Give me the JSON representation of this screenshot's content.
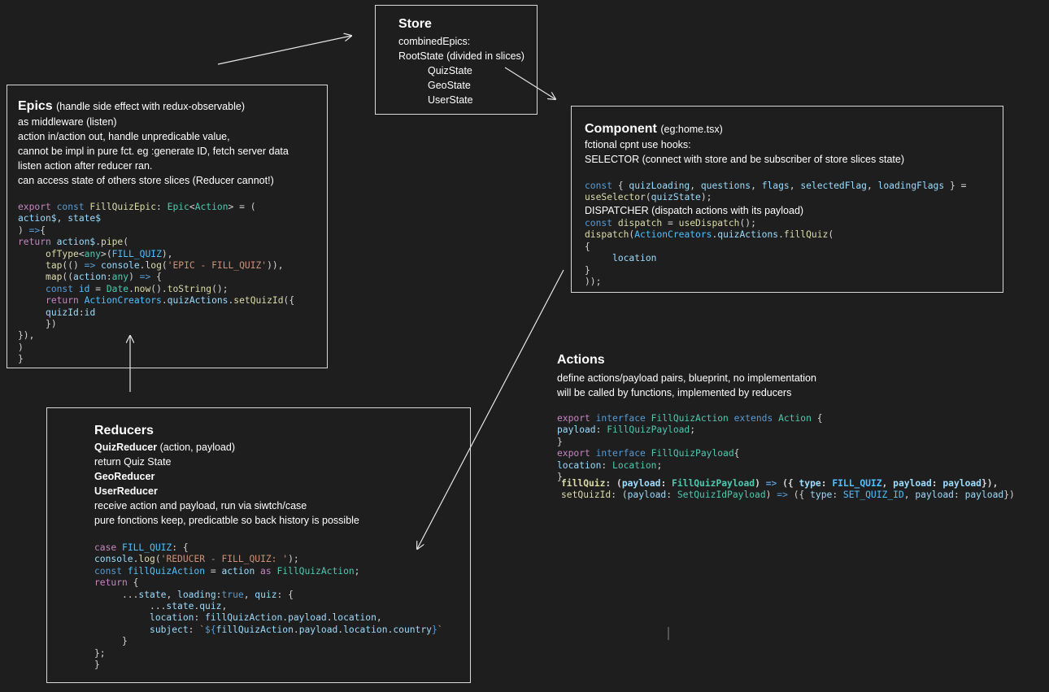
{
  "store": {
    "title": "Store",
    "lines": [
      "combinedEpics:",
      "RootState (divided in slices)",
      "QuizState",
      "GeoState",
      "UserState"
    ]
  },
  "epics": {
    "title": "Epics",
    "subtitle": "(handle side effect with redux-observable)",
    "lines": [
      "as middleware (listen)",
      "action in/action out, handle unpredicable value,",
      "cannot be impl in pure fct. eg :generate ID, fetch server data",
      "listen action after reducer ran.",
      "can access state of others store slices (Reducer cannot!)"
    ],
    "code": [
      [
        [
          "kw",
          "export "
        ],
        [
          "kb",
          "const "
        ],
        [
          "fn",
          "FillQuizEpic"
        ],
        [
          "",
          "："
        ],
        [
          "ty",
          "Epic"
        ],
        [
          "",
          "<"
        ],
        [
          "ty",
          "Action"
        ],
        [
          "",
          "> = ("
        ]
      ],
      [
        [
          "vr",
          "action$"
        ],
        [
          "",
          ", "
        ],
        [
          "vr",
          "state$"
        ]
      ],
      [
        [
          "",
          ") "
        ],
        [
          "kb",
          "=>"
        ],
        [
          "",
          "{"
        ]
      ],
      [
        [
          "kw",
          "return "
        ],
        [
          "vr",
          "action$"
        ],
        [
          "",
          "."
        ],
        [
          "fn",
          "pipe"
        ],
        [
          "",
          "("
        ]
      ],
      [
        [
          "",
          "     "
        ],
        [
          "fn",
          "ofType"
        ],
        [
          "",
          "<"
        ],
        [
          "ty",
          "any"
        ],
        [
          "",
          ">("
        ],
        [
          "cn",
          "FILL_QUIZ"
        ],
        [
          "",
          "),"
        ]
      ],
      [
        [
          "",
          "     "
        ],
        [
          "fn",
          "tap"
        ],
        [
          "",
          "(() "
        ],
        [
          "kb",
          "=> "
        ],
        [
          "vr",
          "console"
        ],
        [
          "",
          "."
        ],
        [
          "fn",
          "log"
        ],
        [
          "",
          "("
        ],
        [
          "st",
          "'EPIC - FILL_QUIZ'"
        ],
        [
          "",
          ")),"
        ]
      ],
      [
        [
          "",
          "     "
        ],
        [
          "fn",
          "map"
        ],
        [
          "",
          "(("
        ],
        [
          "vr",
          "action"
        ],
        [
          "",
          ":"
        ],
        [
          "ty",
          "any"
        ],
        [
          "",
          ") "
        ],
        [
          "kb",
          "=> "
        ],
        [
          "",
          "{"
        ]
      ],
      [
        [
          "",
          "     "
        ],
        [
          "kb",
          "const "
        ],
        [
          "cn",
          "id"
        ],
        [
          "",
          " = "
        ],
        [
          "ty",
          "Date"
        ],
        [
          "",
          "."
        ],
        [
          "fn",
          "now"
        ],
        [
          "",
          "()."
        ],
        [
          "fn",
          "toString"
        ],
        [
          "",
          "();"
        ]
      ],
      [
        [
          "",
          "     "
        ],
        [
          "kw",
          "return "
        ],
        [
          "cn",
          "ActionCreators"
        ],
        [
          "",
          "."
        ],
        [
          "vr",
          "quizActions"
        ],
        [
          "",
          "."
        ],
        [
          "fn",
          "setQuizId"
        ],
        [
          "",
          "({"
        ]
      ],
      [
        [
          "",
          "     "
        ],
        [
          "vr",
          "quizId"
        ],
        [
          "",
          ":"
        ],
        [
          "vr",
          "id"
        ]
      ],
      [
        [
          "",
          "     "
        ],
        [
          "",
          "})"
        ]
      ],
      [
        [
          "",
          "}),"
        ]
      ],
      [
        [
          "",
          ")"
        ]
      ],
      [
        [
          "",
          "}"
        ]
      ]
    ]
  },
  "component": {
    "title": "Component",
    "subtitle": "(eg:home.tsx)",
    "lines": [
      "fctional cpnt use hooks:",
      "SELECTOR (connect with store and be subscriber of store slices state)"
    ],
    "dispatcher_label": "DISPATCHER (dispatch actions with its payload)",
    "code_a": [
      [
        [
          "kb",
          "const "
        ],
        [
          "",
          "{ "
        ],
        [
          "vr",
          "quizLoading"
        ],
        [
          "",
          ", "
        ],
        [
          "vr",
          "questions"
        ],
        [
          "",
          ", "
        ],
        [
          "vr",
          "flags"
        ],
        [
          "",
          ", "
        ],
        [
          "vr",
          "selectedFlag"
        ],
        [
          "",
          ", "
        ],
        [
          "vr",
          "loadingFlags"
        ],
        [
          "",
          " } ="
        ]
      ],
      [
        [
          "fn",
          "useSelector"
        ],
        [
          "",
          "("
        ],
        [
          "vr",
          "quizState"
        ],
        [
          "",
          ");"
        ]
      ]
    ],
    "code_b": [
      [
        [
          "kb",
          "const "
        ],
        [
          "fn",
          "dispatch"
        ],
        [
          "",
          " = "
        ],
        [
          "fn",
          "useDispatch"
        ],
        [
          "",
          "();"
        ]
      ],
      [
        [
          "fn",
          "dispatch"
        ],
        [
          "",
          "("
        ],
        [
          "cn",
          "ActionCreators"
        ],
        [
          "",
          "."
        ],
        [
          "vr",
          "quizActions"
        ],
        [
          "",
          "."
        ],
        [
          "fn",
          "fillQuiz"
        ],
        [
          "",
          "("
        ]
      ],
      [
        [
          "",
          "{"
        ]
      ],
      [
        [
          "",
          "     "
        ],
        [
          "vr",
          "location"
        ]
      ],
      [
        [
          "",
          "}"
        ]
      ],
      [
        [
          "",
          "));"
        ]
      ]
    ]
  },
  "actions": {
    "title": "Actions",
    "lines": [
      "define actions/payload pairs, blueprint, no implementation",
      "will be called by functions, implemented by reducers"
    ],
    "code": [
      [
        [
          "kw",
          "export "
        ],
        [
          "kb",
          "interface "
        ],
        [
          "ty",
          "FillQuizAction "
        ],
        [
          "kb",
          "extends "
        ],
        [
          "ty",
          "Action "
        ],
        [
          "",
          "{"
        ]
      ],
      [
        [
          "vr",
          "payload"
        ],
        [
          "",
          ": "
        ],
        [
          "ty",
          "FillQuizPayload"
        ],
        [
          "",
          ";"
        ]
      ],
      [
        [
          "",
          "}"
        ]
      ],
      [
        [
          "kw",
          "export "
        ],
        [
          "kb",
          "interface "
        ],
        [
          "ty",
          "FillQuizPayload"
        ],
        [
          "",
          "{"
        ]
      ],
      [
        [
          "vr",
          "location"
        ],
        [
          "",
          ": "
        ],
        [
          "ty",
          "Location"
        ],
        [
          "",
          ";"
        ]
      ],
      [
        [
          "",
          "}"
        ]
      ]
    ],
    "code_bold": [
      [
        [
          "fn",
          "fillQuiz"
        ],
        [
          "",
          ": ("
        ],
        [
          "vr",
          "payload"
        ],
        [
          "",
          ": "
        ],
        [
          "ty",
          "FillQuizPayload"
        ],
        [
          "",
          ") "
        ],
        [
          "kb",
          "=> "
        ],
        [
          "",
          "({ "
        ],
        [
          "vr",
          "type"
        ],
        [
          "",
          ": "
        ],
        [
          "cn",
          "FILL_QUIZ"
        ],
        [
          "",
          ", "
        ],
        [
          "vr",
          "payload"
        ],
        [
          "",
          ": "
        ],
        [
          "vr",
          "payload"
        ],
        [
          "",
          "}),"
        ]
      ]
    ],
    "code_tail": [
      [
        [
          "fn",
          "setQuizId"
        ],
        [
          "",
          ": ("
        ],
        [
          "vr",
          "payload"
        ],
        [
          "",
          ": "
        ],
        [
          "ty",
          "SetQuizIdPayload"
        ],
        [
          "",
          ") "
        ],
        [
          "kb",
          "=> "
        ],
        [
          "",
          "({ "
        ],
        [
          "vr",
          "type"
        ],
        [
          "",
          ": "
        ],
        [
          "cn",
          "SET_QUIZ_ID"
        ],
        [
          "",
          ", "
        ],
        [
          "vr",
          "payload"
        ],
        [
          "",
          ": "
        ],
        [
          "vr",
          "payload"
        ],
        [
          "",
          "})"
        ]
      ]
    ]
  },
  "reducers": {
    "title": "Reducers",
    "quiz_reducer": "QuizReducer",
    "quiz_reducer_args": "(action, payload)",
    "return_text": "return Quiz State",
    "geo_reducer": "GeoReducer",
    "user_reducer": "UserReducer",
    "lines": [
      "receive action and payload, run via siwtch/case",
      "pure fonctions keep, predicatble so back history is possible"
    ],
    "code": [
      [
        [
          "kw",
          "case "
        ],
        [
          "cn",
          "FILL_QUIZ"
        ],
        [
          "",
          ": {"
        ]
      ],
      [
        [
          "vr",
          "console"
        ],
        [
          "",
          "."
        ],
        [
          "fn",
          "log"
        ],
        [
          "",
          "("
        ],
        [
          "st",
          "'REDUCER - FILL_QUIZ: '"
        ],
        [
          "",
          ");"
        ]
      ],
      [
        [
          "kb",
          "const "
        ],
        [
          "cn",
          "fillQuizAction"
        ],
        [
          "",
          " = "
        ],
        [
          "vr",
          "action "
        ],
        [
          "kw",
          "as "
        ],
        [
          "ty",
          "FillQuizAction"
        ],
        [
          "",
          ";"
        ]
      ],
      [
        [
          "kw",
          "return "
        ],
        [
          "",
          "{"
        ]
      ],
      [
        [
          "",
          "     ..."
        ],
        [
          "vr",
          "state"
        ],
        [
          "",
          ", "
        ],
        [
          "vr",
          "loading"
        ],
        [
          "",
          ":"
        ],
        [
          "kb",
          "true"
        ],
        [
          "",
          ", "
        ],
        [
          "vr",
          "quiz"
        ],
        [
          "",
          ": {"
        ]
      ],
      [
        [
          "",
          "          ..."
        ],
        [
          "vr",
          "state"
        ],
        [
          "",
          "."
        ],
        [
          "vr",
          "quiz"
        ],
        [
          "",
          ","
        ]
      ],
      [
        [
          "",
          "          "
        ],
        [
          "vr",
          "location"
        ],
        [
          "",
          ": "
        ],
        [
          "vr",
          "fillQuizAction"
        ],
        [
          "",
          "."
        ],
        [
          "vr",
          "payload"
        ],
        [
          "",
          "."
        ],
        [
          "vr",
          "location"
        ],
        [
          "",
          ","
        ]
      ],
      [
        [
          "",
          "          "
        ],
        [
          "vr",
          "subject"
        ],
        [
          "",
          ": "
        ],
        [
          "st",
          "`"
        ],
        [
          "kb",
          "${"
        ],
        [
          "vr",
          "fillQuizAction"
        ],
        [
          "",
          "."
        ],
        [
          "vr",
          "payload"
        ],
        [
          "",
          "."
        ],
        [
          "vr",
          "location"
        ],
        [
          "",
          "."
        ],
        [
          "vr",
          "country"
        ],
        [
          "kb",
          "}"
        ],
        [
          "st",
          "`"
        ]
      ],
      [
        [
          "",
          "     }"
        ]
      ],
      [
        [
          "",
          "};"
        ]
      ],
      [
        [
          "",
          "}"
        ]
      ]
    ]
  }
}
